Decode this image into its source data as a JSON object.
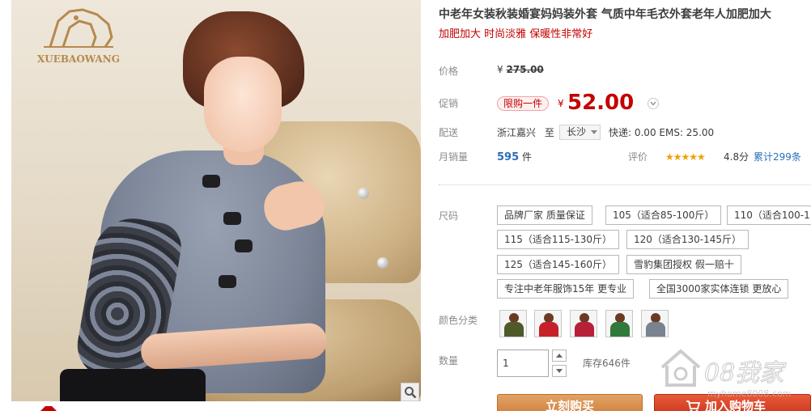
{
  "brand": {
    "logo_text": "XUEBAOWANG"
  },
  "product": {
    "title": "中老年女装秋装婚宴妈妈装外套 气质中年毛衣外套老年人加肥加大",
    "subtitle": "加肥加大 时尚淡雅 保暖性非常好"
  },
  "price": {
    "label": "价格",
    "currency": "¥",
    "original": "275.00"
  },
  "promo": {
    "label": "促销",
    "tag": "限购一件",
    "currency": "¥",
    "price": "52.00",
    "more_icon": "chevron-down-icon"
  },
  "shipping": {
    "label": "配送",
    "from": "浙江嘉兴",
    "to_word": "至",
    "to_city": "长沙",
    "fee": "快递: 0.00 EMS: 25.00"
  },
  "sales": {
    "label": "月销量",
    "count": "595",
    "unit": "件"
  },
  "rating": {
    "label": "评价",
    "stars": "★★★★★",
    "score": "4.8分",
    "review_link": "累计299条"
  },
  "size": {
    "label": "尺码",
    "options": [
      "品牌厂家 质量保证",
      "105（适合85-100斤）",
      "110（适合100-1",
      "115（适合115-130斤）",
      "120（适合130-145斤）",
      "125（适合145-160斤）",
      "雪豹集团授权 假一赔十",
      "专注中老年服饰15年 更专业",
      "全国3000家实体连锁 更放心"
    ]
  },
  "color": {
    "label": "颜色分类",
    "swatch_colors": [
      "#4f5a2a",
      "#c8202a",
      "#b8203a",
      "#2f7a3a",
      "#7a8290"
    ]
  },
  "quantity": {
    "label": "数量",
    "value": "1",
    "stock": "库存646件"
  },
  "actions": {
    "buy_now": "立刻购买",
    "add_to_cart": "加入购物车"
  },
  "watermark": {
    "text": "08我家",
    "url": "myhome8008.com"
  },
  "theme": {
    "accent": "#c40000",
    "link": "#2a6fb8",
    "buy": "#d07a3a",
    "cart": "#c8321a"
  }
}
